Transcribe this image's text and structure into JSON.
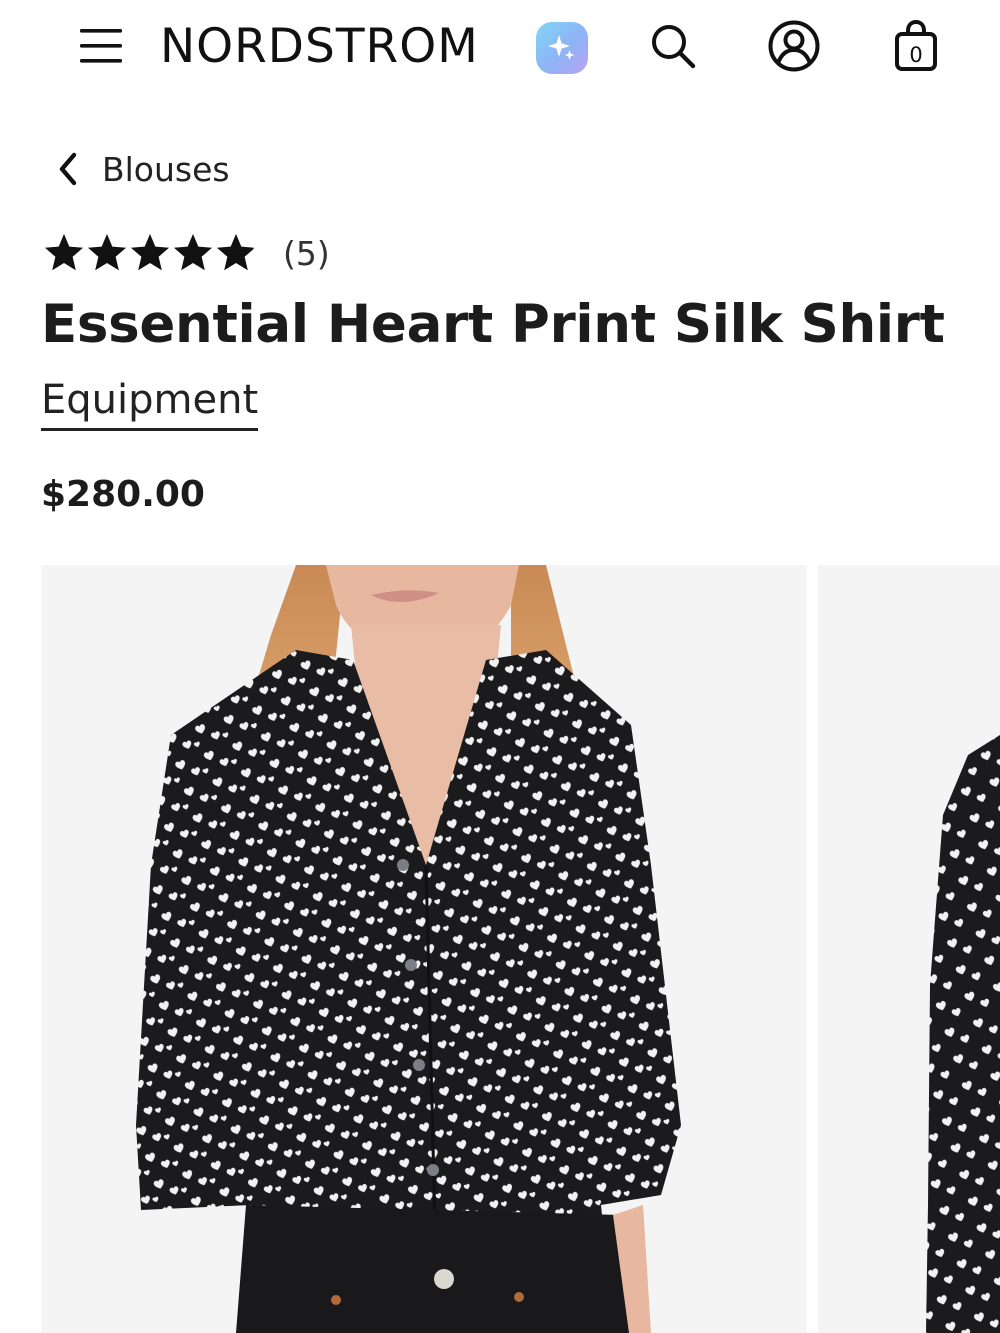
{
  "header": {
    "logo": "NORDSTROM",
    "menu_icon": "hamburger-menu-icon",
    "ai_icon": "sparkle-icon",
    "search_icon": "search-icon",
    "account_icon": "account-icon",
    "bag_icon": "shopping-bag-icon",
    "bag_count": "0",
    "ai_colors": [
      "#7fd6f7",
      "#8fb3f5",
      "#b8a2f2"
    ]
  },
  "breadcrumb": {
    "back_icon": "chevron-left-icon",
    "label": "Blouses"
  },
  "product": {
    "rating": {
      "value": 4.9,
      "max": 5,
      "count_label": "(5)"
    },
    "title": "Essential Heart Print Silk Shirt",
    "brand": "Equipment",
    "price": "$280.00"
  },
  "gallery": {
    "images": [
      {
        "name": "product-photo-front"
      },
      {
        "name": "product-photo-next"
      }
    ]
  }
}
